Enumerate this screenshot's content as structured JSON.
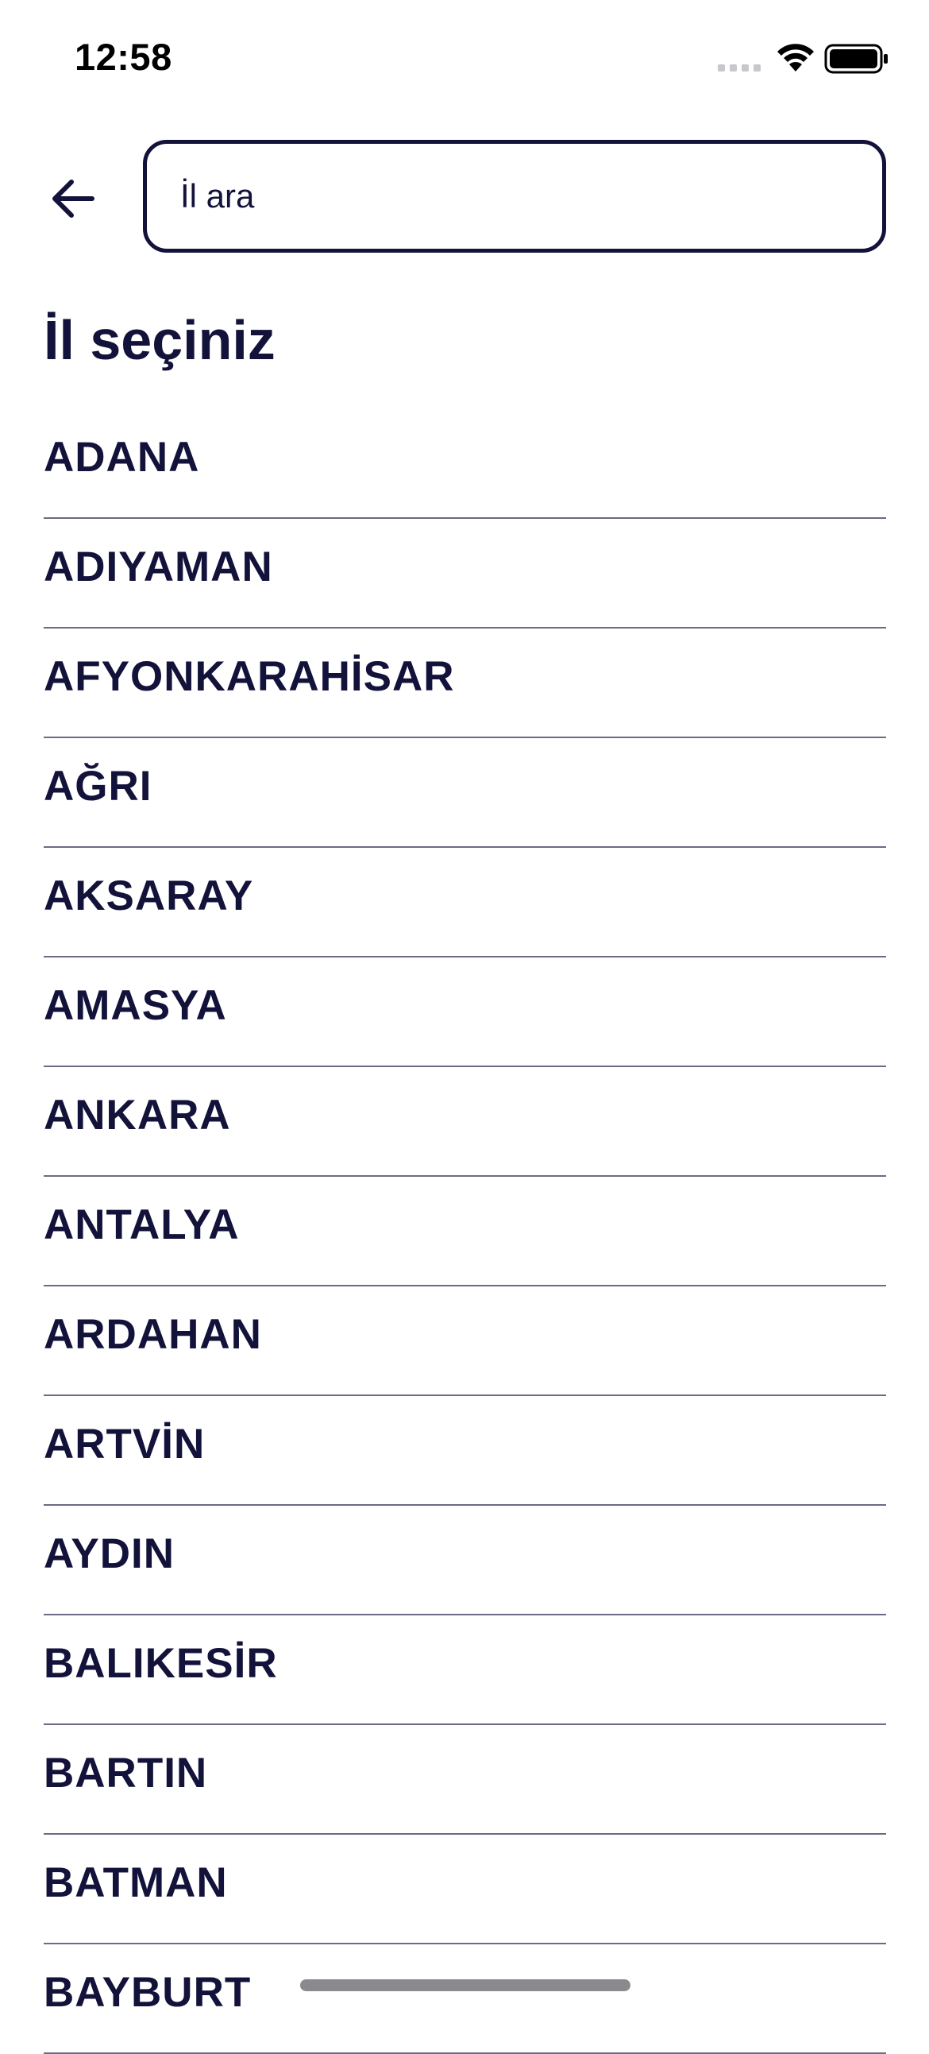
{
  "status_bar": {
    "time": "12:58",
    "icons": [
      "signal-dots-icon",
      "wifi-icon",
      "battery-icon"
    ]
  },
  "header": {
    "back_icon": "arrow-left-icon",
    "search": {
      "value": "",
      "placeholder": "İl ara"
    }
  },
  "title": "İl seçiniz",
  "provinces": [
    "ADANA",
    "ADIYAMAN",
    "AFYONKARAHİSAR",
    "AĞRI",
    "AKSARAY",
    "AMASYA",
    "ANKARA",
    "ANTALYA",
    "ARDAHAN",
    "ARTVİN",
    "AYDIN",
    "BALIKESİR",
    "BARTIN",
    "BATMAN",
    "BAYBURT"
  ],
  "colors": {
    "text": "#12123a",
    "divider": "#6b6b85",
    "background": "#ffffff"
  }
}
